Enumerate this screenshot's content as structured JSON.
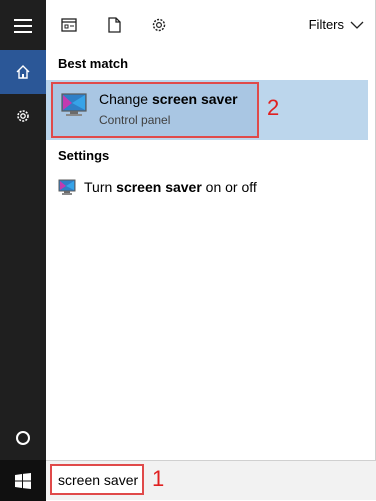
{
  "toolbar": {
    "filters_label": "Filters"
  },
  "best_match": {
    "heading": "Best match",
    "title_prefix": "Change ",
    "title_bold": "screen saver",
    "subtitle": "Control panel",
    "annotation": "2"
  },
  "settings": {
    "heading": "Settings",
    "item_prefix": "Turn ",
    "item_bold": "screen saver",
    "item_suffix": " on or off"
  },
  "search": {
    "value": "screen saver",
    "annotation": "1"
  },
  "colors": {
    "sidebar_bg": "#1f1f1f",
    "home_active_bg": "#2b5797",
    "highlight_bg": "#bcd6ec",
    "annotation_red": "#e02020"
  },
  "icons": [
    "hamburger-icon",
    "home-icon",
    "gear-icon",
    "circle-icon",
    "windows-logo-icon",
    "apps-icon",
    "document-icon",
    "settings-gear-icon",
    "chevron-down-icon",
    "screensaver-icon"
  ]
}
